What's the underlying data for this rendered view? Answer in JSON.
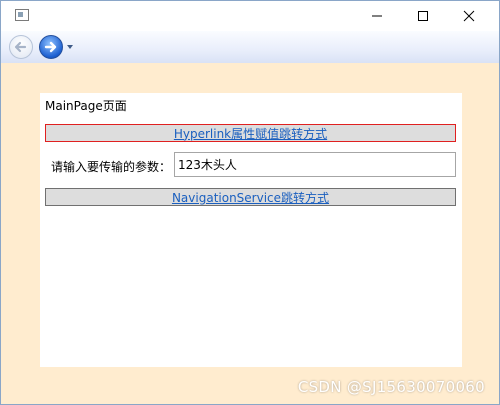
{
  "window": {
    "controls": {
      "minimize_icon": "minimize-icon",
      "maximize_icon": "maximize-icon",
      "close_icon": "close-icon"
    }
  },
  "navigation": {
    "back_icon": "back-arrow-icon",
    "forward_icon": "forward-arrow-icon",
    "history_icon": "chevron-down-icon"
  },
  "page": {
    "title": "MainPage页面",
    "hyperlink_label": "Hyperlink属性赋值跳转方式",
    "param_label": "请输入要传输的参数：",
    "param_value": "123木头人",
    "navigation_service_label": "NavigationService跳转方式"
  },
  "watermark": "CSDN @SJ15630070060",
  "colors": {
    "window_background": "#ffeccf",
    "link": "#1a5fbf",
    "focused_border": "#e02020",
    "button_background": "#dddddd"
  }
}
